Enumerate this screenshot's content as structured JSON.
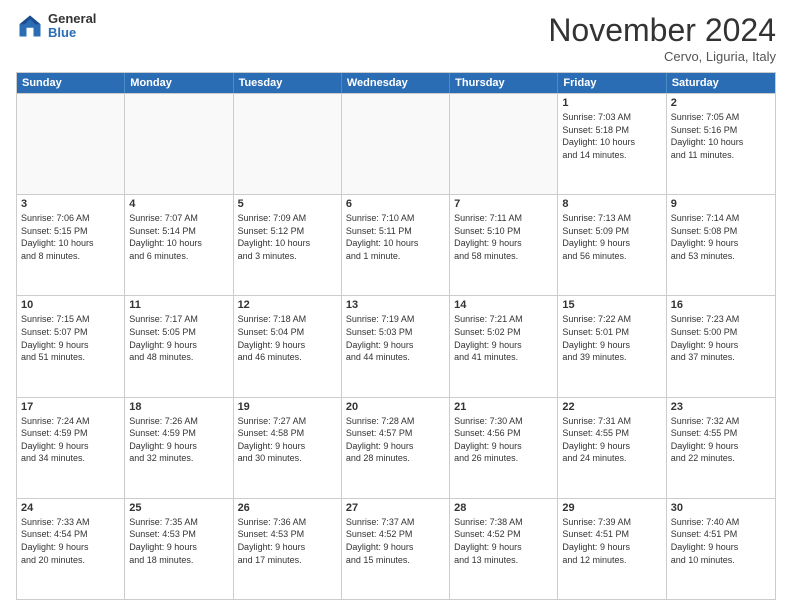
{
  "logo": {
    "general": "General",
    "blue": "Blue"
  },
  "title": "November 2024",
  "location": "Cervo, Liguria, Italy",
  "days": [
    "Sunday",
    "Monday",
    "Tuesday",
    "Wednesday",
    "Thursday",
    "Friday",
    "Saturday"
  ],
  "rows": [
    [
      {
        "day": "",
        "info": "",
        "empty": true
      },
      {
        "day": "",
        "info": "",
        "empty": true
      },
      {
        "day": "",
        "info": "",
        "empty": true
      },
      {
        "day": "",
        "info": "",
        "empty": true
      },
      {
        "day": "",
        "info": "",
        "empty": true
      },
      {
        "day": "1",
        "info": "Sunrise: 7:03 AM\nSunset: 5:18 PM\nDaylight: 10 hours\nand 14 minutes.",
        "empty": false
      },
      {
        "day": "2",
        "info": "Sunrise: 7:05 AM\nSunset: 5:16 PM\nDaylight: 10 hours\nand 11 minutes.",
        "empty": false
      }
    ],
    [
      {
        "day": "3",
        "info": "Sunrise: 7:06 AM\nSunset: 5:15 PM\nDaylight: 10 hours\nand 8 minutes.",
        "empty": false
      },
      {
        "day": "4",
        "info": "Sunrise: 7:07 AM\nSunset: 5:14 PM\nDaylight: 10 hours\nand 6 minutes.",
        "empty": false
      },
      {
        "day": "5",
        "info": "Sunrise: 7:09 AM\nSunset: 5:12 PM\nDaylight: 10 hours\nand 3 minutes.",
        "empty": false
      },
      {
        "day": "6",
        "info": "Sunrise: 7:10 AM\nSunset: 5:11 PM\nDaylight: 10 hours\nand 1 minute.",
        "empty": false
      },
      {
        "day": "7",
        "info": "Sunrise: 7:11 AM\nSunset: 5:10 PM\nDaylight: 9 hours\nand 58 minutes.",
        "empty": false
      },
      {
        "day": "8",
        "info": "Sunrise: 7:13 AM\nSunset: 5:09 PM\nDaylight: 9 hours\nand 56 minutes.",
        "empty": false
      },
      {
        "day": "9",
        "info": "Sunrise: 7:14 AM\nSunset: 5:08 PM\nDaylight: 9 hours\nand 53 minutes.",
        "empty": false
      }
    ],
    [
      {
        "day": "10",
        "info": "Sunrise: 7:15 AM\nSunset: 5:07 PM\nDaylight: 9 hours\nand 51 minutes.",
        "empty": false
      },
      {
        "day": "11",
        "info": "Sunrise: 7:17 AM\nSunset: 5:05 PM\nDaylight: 9 hours\nand 48 minutes.",
        "empty": false
      },
      {
        "day": "12",
        "info": "Sunrise: 7:18 AM\nSunset: 5:04 PM\nDaylight: 9 hours\nand 46 minutes.",
        "empty": false
      },
      {
        "day": "13",
        "info": "Sunrise: 7:19 AM\nSunset: 5:03 PM\nDaylight: 9 hours\nand 44 minutes.",
        "empty": false
      },
      {
        "day": "14",
        "info": "Sunrise: 7:21 AM\nSunset: 5:02 PM\nDaylight: 9 hours\nand 41 minutes.",
        "empty": false
      },
      {
        "day": "15",
        "info": "Sunrise: 7:22 AM\nSunset: 5:01 PM\nDaylight: 9 hours\nand 39 minutes.",
        "empty": false
      },
      {
        "day": "16",
        "info": "Sunrise: 7:23 AM\nSunset: 5:00 PM\nDaylight: 9 hours\nand 37 minutes.",
        "empty": false
      }
    ],
    [
      {
        "day": "17",
        "info": "Sunrise: 7:24 AM\nSunset: 4:59 PM\nDaylight: 9 hours\nand 34 minutes.",
        "empty": false
      },
      {
        "day": "18",
        "info": "Sunrise: 7:26 AM\nSunset: 4:59 PM\nDaylight: 9 hours\nand 32 minutes.",
        "empty": false
      },
      {
        "day": "19",
        "info": "Sunrise: 7:27 AM\nSunset: 4:58 PM\nDaylight: 9 hours\nand 30 minutes.",
        "empty": false
      },
      {
        "day": "20",
        "info": "Sunrise: 7:28 AM\nSunset: 4:57 PM\nDaylight: 9 hours\nand 28 minutes.",
        "empty": false
      },
      {
        "day": "21",
        "info": "Sunrise: 7:30 AM\nSunset: 4:56 PM\nDaylight: 9 hours\nand 26 minutes.",
        "empty": false
      },
      {
        "day": "22",
        "info": "Sunrise: 7:31 AM\nSunset: 4:55 PM\nDaylight: 9 hours\nand 24 minutes.",
        "empty": false
      },
      {
        "day": "23",
        "info": "Sunrise: 7:32 AM\nSunset: 4:55 PM\nDaylight: 9 hours\nand 22 minutes.",
        "empty": false
      }
    ],
    [
      {
        "day": "24",
        "info": "Sunrise: 7:33 AM\nSunset: 4:54 PM\nDaylight: 9 hours\nand 20 minutes.",
        "empty": false
      },
      {
        "day": "25",
        "info": "Sunrise: 7:35 AM\nSunset: 4:53 PM\nDaylight: 9 hours\nand 18 minutes.",
        "empty": false
      },
      {
        "day": "26",
        "info": "Sunrise: 7:36 AM\nSunset: 4:53 PM\nDaylight: 9 hours\nand 17 minutes.",
        "empty": false
      },
      {
        "day": "27",
        "info": "Sunrise: 7:37 AM\nSunset: 4:52 PM\nDaylight: 9 hours\nand 15 minutes.",
        "empty": false
      },
      {
        "day": "28",
        "info": "Sunrise: 7:38 AM\nSunset: 4:52 PM\nDaylight: 9 hours\nand 13 minutes.",
        "empty": false
      },
      {
        "day": "29",
        "info": "Sunrise: 7:39 AM\nSunset: 4:51 PM\nDaylight: 9 hours\nand 12 minutes.",
        "empty": false
      },
      {
        "day": "30",
        "info": "Sunrise: 7:40 AM\nSunset: 4:51 PM\nDaylight: 9 hours\nand 10 minutes.",
        "empty": false
      }
    ]
  ]
}
